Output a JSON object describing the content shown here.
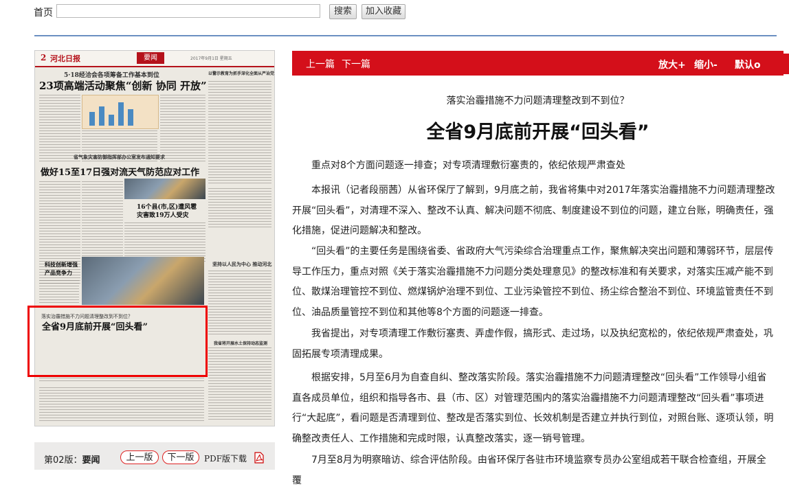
{
  "topbar": {
    "home_label": "首页",
    "search_value": "",
    "search_button": "搜索",
    "favorite_button": "加入收藏"
  },
  "newspaper": {
    "page_no": "2",
    "masthead": "河北日报",
    "section": "要闻",
    "date_line": "2017年9月1日 星期五",
    "headline_main_kicker": "5·18经洽会各项筹备工作基本到位",
    "headline_main": "23项高端活动聚焦“创新 协同 开放”",
    "headline_weather_kicker": "省气象灾害防御指挥部办公室发布通知要求",
    "headline_weather": "做好15至17日强对流天气防范应对工作",
    "headline_disaster": "16个县(市,区)遭风雹",
    "headline_disaster_2": "灾害致19万人受灾",
    "headline_tech": "科技创新增强",
    "headline_tech_2": "产品竞争力",
    "headline_right_1": "以警示教育为抓手深化全面从严治党",
    "headline_right_2": "坚持以人民为中心 推动河北",
    "headline_right_3": "我省将开展水土保持动态监测",
    "highlight_kicker": "落实治霾措施不力问题清理整改到不到位？",
    "highlight_title": "全省9月底前开展“回头看”"
  },
  "pager": {
    "page_prefix": "第02版：",
    "page_name": "要闻",
    "prev_page": "上一版",
    "next_page": "下一版",
    "pdf_download": "PDF版下载"
  },
  "article_toolbar": {
    "prev": "上一篇",
    "next": "下一篇",
    "zoom_in": "放大+",
    "zoom_out": "缩小-",
    "reset": "默认o"
  },
  "article": {
    "subtitle": "落实治霾措施不力问题清理整改到不到位？",
    "title": "全省9月底前开展“回头看”",
    "paragraphs": [
      "重点对8个方面问题逐一排查；对专项清理敷衍塞责的，依纪依规严肃查处",
      "本报讯（记者段丽茜）从省环保厅了解到，9月底之前，我省将集中对2017年落实治霾措施不力问题清理整改开展“回头看”，对清理不深入、整改不认真、解决问题不彻底、制度建设不到位的问题，建立台账，明确责任，强化措施，促进问题解决和整改。",
      "“回头看”的主要任务是围绕省委、省政府大气污染综合治理重点工作，聚焦解决突出问题和薄弱环节，层层传导工作压力，重点对照《关于落实治霾措施不力问题分类处理意见》的整改标准和有关要求，对落实压减产能不到位、散煤治理管控不到位、燃煤锅炉治理不到位、工业污染管控不到位、扬尘综合整治不到位、环境监管责任不到位、油品质量管控不到位和其他等8个方面的问题逐一排查。",
      "我省提出，对专项清理工作敷衍塞责、弄虚作假，搞形式、走过场，以及执纪宽松的，依纪依规严肃查处，巩固拓展专项清理成果。",
      "根据安排，5月至6月为自查自纠、整改落实阶段。落实治霾措施不力问题清理整改“回头看”工作领导小组省直各成员单位，组织和指导各市、县（市、区）对管理范围内的落实治霾措施不力问题清理整改“回头看”事项进行“大起底”，看问题是否清理到位、整改是否落实到位、长效机制是否建立并执行到位，对照台账、逐项认领，明确整改责任人、工作措施和完成时限，认真整改落实，逐一销号管理。",
      "7月至8月为明察暗访、综合评估阶段。由省环保厅各驻市环境监察专员办公室组成若干联合检查组，开展全覆"
    ]
  },
  "colors": {
    "accent_red": "#d40f1a",
    "divider_blue": "#6b8fc2"
  }
}
